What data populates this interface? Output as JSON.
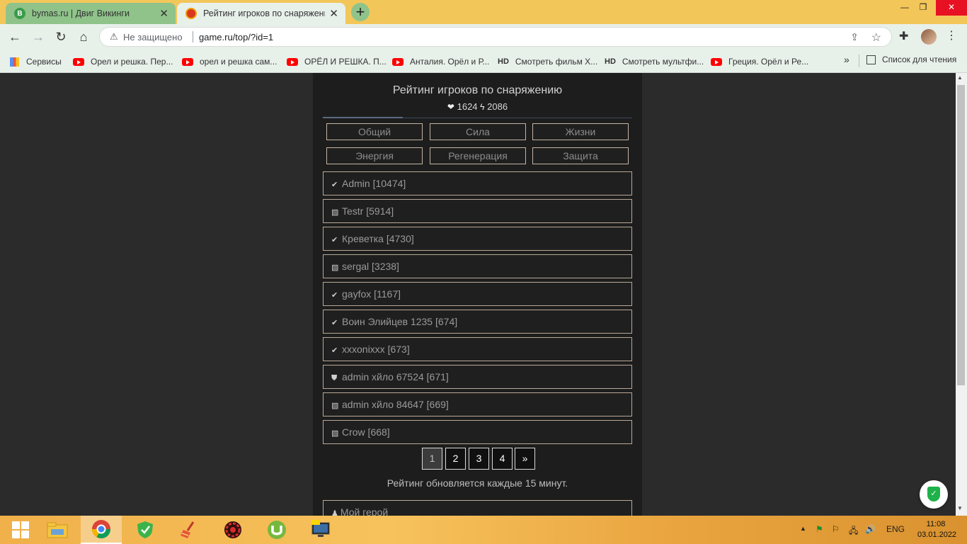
{
  "browser": {
    "tabs": [
      {
        "title": "bymas.ru | Двиг Викинги",
        "favicon_letter": "B",
        "favicon_color": "#3a9b4b",
        "active": false
      },
      {
        "title": "Рейтинг игроков по снаряжени",
        "favicon_letter": "",
        "favicon_color": "#d9381e",
        "active": true
      }
    ],
    "new_tab": "+",
    "window_controls": {
      "minimize": "—",
      "maximize": "❐",
      "close": "✕"
    },
    "nav": {
      "back": "←",
      "forward": "→",
      "reload": "↻",
      "home": "⌂"
    },
    "address": {
      "security_label": "Не защищено",
      "url": "game.ru/top/?id=1"
    },
    "bookmarks": [
      {
        "label": "Сервисы",
        "type": "apps"
      },
      {
        "label": "Орел и решка. Пер...",
        "type": "yt"
      },
      {
        "label": "орел и решка сам...",
        "type": "yt"
      },
      {
        "label": "ОРЁЛ И РЕШКА. П...",
        "type": "yt"
      },
      {
        "label": "Анталия. Орёл и Р...",
        "type": "yt"
      },
      {
        "label": "Смотреть фильм Х...",
        "type": "hd"
      },
      {
        "label": "Смотреть мультфи...",
        "type": "hd"
      },
      {
        "label": "Греция. Орёл и Ре...",
        "type": "yt"
      }
    ],
    "hd_badge": "HD",
    "bookmarks_more": "»",
    "reading_list": "Список для чтения"
  },
  "page": {
    "title": "Рейтинг игроков по снаряжению",
    "stats": {
      "health": "1624",
      "energy": "2086"
    },
    "categories": [
      "Общий",
      "Сила",
      "Жизни",
      "Энергия",
      "Регенерация",
      "Защита"
    ],
    "players": [
      {
        "name": "Admin [10474]",
        "icon": "✔"
      },
      {
        "name": "Testr [5914]",
        "icon": "▧"
      },
      {
        "name": "Креветка [4730]",
        "icon": "✔"
      },
      {
        "name": "sergal [3238]",
        "icon": "▧"
      },
      {
        "name": "gayfox [1167]",
        "icon": "✔"
      },
      {
        "name": "Воин Элийцев 1235 [674]",
        "icon": "✔"
      },
      {
        "name": "xxxonixxx [673]",
        "icon": "✔"
      },
      {
        "name": "admin хйло 67524 [671]",
        "icon": "⛊"
      },
      {
        "name": "admin хйло 84647 [669]",
        "icon": "▧"
      },
      {
        "name": "Crow [668]",
        "icon": "▧"
      }
    ],
    "pagination": [
      "1",
      "2",
      "3",
      "4",
      "»"
    ],
    "current_page": "1",
    "update_note": "Рейтинг обновляется каждые 15 минут.",
    "my_hero": "Мой герой"
  },
  "taskbar": {
    "language": "ENG",
    "time": "11:08",
    "date": "03.01.2022"
  }
}
